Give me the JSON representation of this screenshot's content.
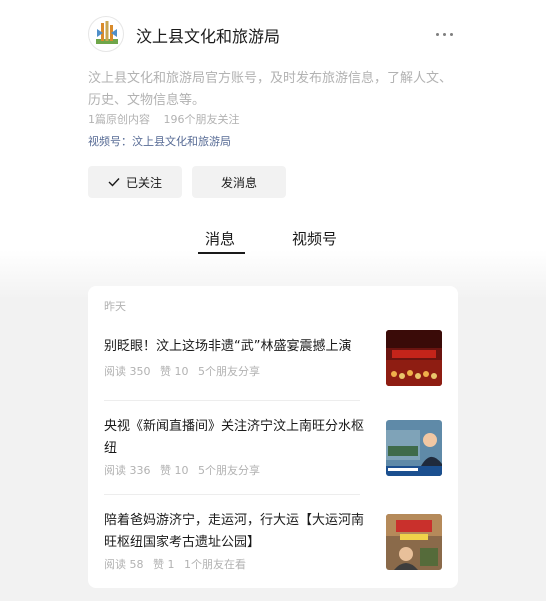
{
  "account": {
    "name": "汶上县文化和旅游局",
    "description": "汶上县文化和旅游局官方账号，及时发布旅游信息，了解人文、历史、文物信息等。",
    "original_count": "1篇原创内容",
    "friends_following": "196个朋友关注",
    "channel": "视频号：汶上县文化和旅游局"
  },
  "actions": {
    "follow_label": "已关注",
    "message_label": "发消息"
  },
  "tabs": [
    {
      "label": "消息",
      "active": true
    },
    {
      "label": "视频号",
      "active": false
    }
  ],
  "feed": {
    "day_label": "昨天",
    "items": [
      {
        "title": "别眨眼！汶上这场非遗“武”林盛宴震撼上演",
        "reads": "阅读 350",
        "likes": "赞 10",
        "social": "5个朋友分享",
        "thumb": "stage-performance-image"
      },
      {
        "title": "央视《新闻直播间》关注济宁汶上南旺分水枢纽",
        "reads": "阅读 336",
        "likes": "赞 10",
        "social": "5个朋友分享",
        "thumb": "news-anchor-image"
      },
      {
        "title": "陪着爸妈游济宁，走运河，行大运【大运河南旺枢纽国家考古遗址公园】",
        "reads": "阅读 58",
        "likes": "赞 1",
        "social": "1个朋友在看",
        "thumb": "travel-vlog-image"
      }
    ]
  },
  "icons": {
    "more": "more-dots-icon",
    "follow": "checkmark-icon"
  },
  "colors": {
    "link": "#576b95",
    "secondary_text": "#b2b2b2",
    "button_bg": "#f2f2f2",
    "page_bg": "#f2f2f2"
  }
}
